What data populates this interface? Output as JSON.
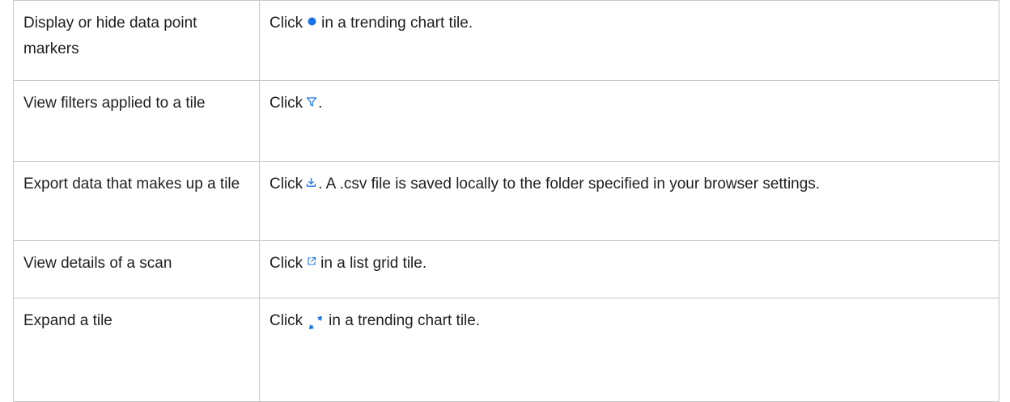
{
  "rows": [
    {
      "task": "Display or hide data point markers",
      "before": "Click",
      "icon": "dot-marker-icon",
      "after": "in a trending chart tile."
    },
    {
      "task": "View filters applied to a tile",
      "before": "Click",
      "icon": "filter-icon",
      "after": "."
    },
    {
      "task": "Export data that makes up a tile",
      "before": "Click",
      "icon": "download-icon",
      "after": ". A .csv file is saved locally to the folder specified in your browser settings."
    },
    {
      "task": "View details of a scan",
      "before": "Click",
      "icon": "external-link-icon",
      "after": "in a list grid tile."
    },
    {
      "task": "Expand a tile",
      "before": "Click",
      "icon": "expand-icon",
      "after": "in a trending chart tile."
    }
  ],
  "colors": {
    "icon_blue": "#1a73e8",
    "border": "#c8c8c8",
    "text": "#1f1f1f"
  }
}
